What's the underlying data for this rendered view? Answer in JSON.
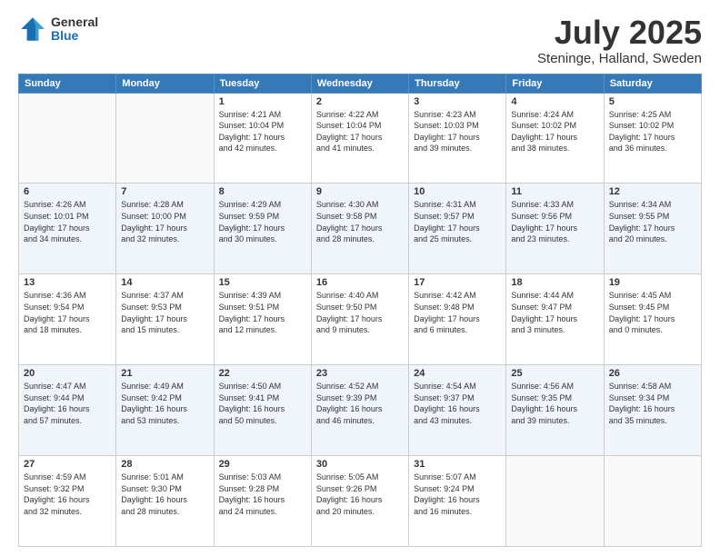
{
  "logo": {
    "general": "General",
    "blue": "Blue"
  },
  "header": {
    "month": "July 2025",
    "location": "Steninge, Halland, Sweden"
  },
  "weekdays": [
    "Sunday",
    "Monday",
    "Tuesday",
    "Wednesday",
    "Thursday",
    "Friday",
    "Saturday"
  ],
  "weeks": [
    [
      {
        "day": "",
        "info": ""
      },
      {
        "day": "",
        "info": ""
      },
      {
        "day": "1",
        "info": "Sunrise: 4:21 AM\nSunset: 10:04 PM\nDaylight: 17 hours\nand 42 minutes."
      },
      {
        "day": "2",
        "info": "Sunrise: 4:22 AM\nSunset: 10:04 PM\nDaylight: 17 hours\nand 41 minutes."
      },
      {
        "day": "3",
        "info": "Sunrise: 4:23 AM\nSunset: 10:03 PM\nDaylight: 17 hours\nand 39 minutes."
      },
      {
        "day": "4",
        "info": "Sunrise: 4:24 AM\nSunset: 10:02 PM\nDaylight: 17 hours\nand 38 minutes."
      },
      {
        "day": "5",
        "info": "Sunrise: 4:25 AM\nSunset: 10:02 PM\nDaylight: 17 hours\nand 36 minutes."
      }
    ],
    [
      {
        "day": "6",
        "info": "Sunrise: 4:26 AM\nSunset: 10:01 PM\nDaylight: 17 hours\nand 34 minutes."
      },
      {
        "day": "7",
        "info": "Sunrise: 4:28 AM\nSunset: 10:00 PM\nDaylight: 17 hours\nand 32 minutes."
      },
      {
        "day": "8",
        "info": "Sunrise: 4:29 AM\nSunset: 9:59 PM\nDaylight: 17 hours\nand 30 minutes."
      },
      {
        "day": "9",
        "info": "Sunrise: 4:30 AM\nSunset: 9:58 PM\nDaylight: 17 hours\nand 28 minutes."
      },
      {
        "day": "10",
        "info": "Sunrise: 4:31 AM\nSunset: 9:57 PM\nDaylight: 17 hours\nand 25 minutes."
      },
      {
        "day": "11",
        "info": "Sunrise: 4:33 AM\nSunset: 9:56 PM\nDaylight: 17 hours\nand 23 minutes."
      },
      {
        "day": "12",
        "info": "Sunrise: 4:34 AM\nSunset: 9:55 PM\nDaylight: 17 hours\nand 20 minutes."
      }
    ],
    [
      {
        "day": "13",
        "info": "Sunrise: 4:36 AM\nSunset: 9:54 PM\nDaylight: 17 hours\nand 18 minutes."
      },
      {
        "day": "14",
        "info": "Sunrise: 4:37 AM\nSunset: 9:53 PM\nDaylight: 17 hours\nand 15 minutes."
      },
      {
        "day": "15",
        "info": "Sunrise: 4:39 AM\nSunset: 9:51 PM\nDaylight: 17 hours\nand 12 minutes."
      },
      {
        "day": "16",
        "info": "Sunrise: 4:40 AM\nSunset: 9:50 PM\nDaylight: 17 hours\nand 9 minutes."
      },
      {
        "day": "17",
        "info": "Sunrise: 4:42 AM\nSunset: 9:48 PM\nDaylight: 17 hours\nand 6 minutes."
      },
      {
        "day": "18",
        "info": "Sunrise: 4:44 AM\nSunset: 9:47 PM\nDaylight: 17 hours\nand 3 minutes."
      },
      {
        "day": "19",
        "info": "Sunrise: 4:45 AM\nSunset: 9:45 PM\nDaylight: 17 hours\nand 0 minutes."
      }
    ],
    [
      {
        "day": "20",
        "info": "Sunrise: 4:47 AM\nSunset: 9:44 PM\nDaylight: 16 hours\nand 57 minutes."
      },
      {
        "day": "21",
        "info": "Sunrise: 4:49 AM\nSunset: 9:42 PM\nDaylight: 16 hours\nand 53 minutes."
      },
      {
        "day": "22",
        "info": "Sunrise: 4:50 AM\nSunset: 9:41 PM\nDaylight: 16 hours\nand 50 minutes."
      },
      {
        "day": "23",
        "info": "Sunrise: 4:52 AM\nSunset: 9:39 PM\nDaylight: 16 hours\nand 46 minutes."
      },
      {
        "day": "24",
        "info": "Sunrise: 4:54 AM\nSunset: 9:37 PM\nDaylight: 16 hours\nand 43 minutes."
      },
      {
        "day": "25",
        "info": "Sunrise: 4:56 AM\nSunset: 9:35 PM\nDaylight: 16 hours\nand 39 minutes."
      },
      {
        "day": "26",
        "info": "Sunrise: 4:58 AM\nSunset: 9:34 PM\nDaylight: 16 hours\nand 35 minutes."
      }
    ],
    [
      {
        "day": "27",
        "info": "Sunrise: 4:59 AM\nSunset: 9:32 PM\nDaylight: 16 hours\nand 32 minutes."
      },
      {
        "day": "28",
        "info": "Sunrise: 5:01 AM\nSunset: 9:30 PM\nDaylight: 16 hours\nand 28 minutes."
      },
      {
        "day": "29",
        "info": "Sunrise: 5:03 AM\nSunset: 9:28 PM\nDaylight: 16 hours\nand 24 minutes."
      },
      {
        "day": "30",
        "info": "Sunrise: 5:05 AM\nSunset: 9:26 PM\nDaylight: 16 hours\nand 20 minutes."
      },
      {
        "day": "31",
        "info": "Sunrise: 5:07 AM\nSunset: 9:24 PM\nDaylight: 16 hours\nand 16 minutes."
      },
      {
        "day": "",
        "info": ""
      },
      {
        "day": "",
        "info": ""
      }
    ]
  ]
}
